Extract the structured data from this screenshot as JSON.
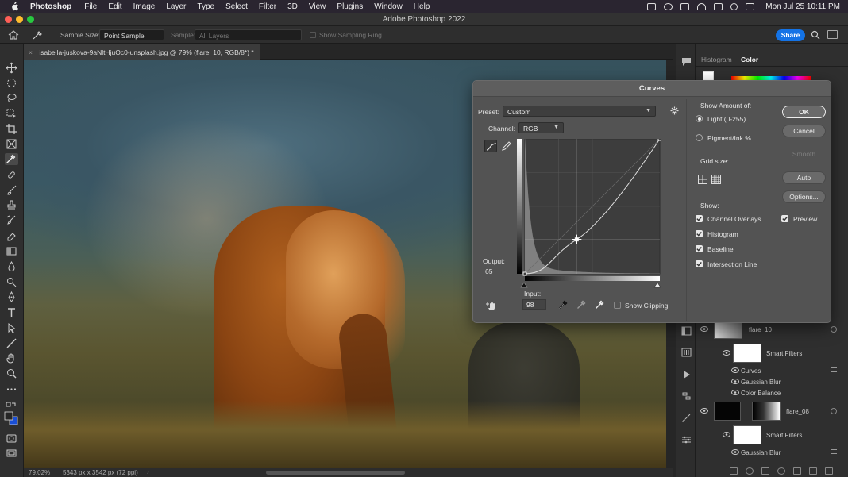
{
  "menubar": {
    "app": "Photoshop",
    "items": [
      "File",
      "Edit",
      "Image",
      "Layer",
      "Type",
      "Select",
      "Filter",
      "3D",
      "View",
      "Plugins",
      "Window",
      "Help"
    ],
    "clock": "Mon Jul 25  10:11 PM"
  },
  "window": {
    "title": "Adobe Photoshop 2022"
  },
  "options": {
    "sample_size_label": "Sample Size:",
    "sample_size_value": "Point Sample",
    "sample_label": "Sample:",
    "sample_value": "All Layers",
    "show_ring_label": "Show Sampling Ring",
    "share_label": "Share"
  },
  "document": {
    "tab": "isabella-juskova-9aNltHjuOc0-unsplash.jpg @ 79% (flare_10, RGB/8*) *",
    "close": "×"
  },
  "status": {
    "zoom": "79.02%",
    "dimensions": "5343 px x 3542 px (72 ppi)",
    "arrow": "›"
  },
  "right_panel": {
    "tabs": [
      "Histogram",
      "Color"
    ],
    "active_tab": "Color",
    "layers": [
      {
        "name": "flare_10",
        "type": "layer"
      },
      {
        "name": "Smart Filters",
        "type": "smart"
      },
      {
        "name": "Curves",
        "type": "filter"
      },
      {
        "name": "Gaussian Blur",
        "type": "filter"
      },
      {
        "name": "Color Balance",
        "type": "filter"
      },
      {
        "name": "flare_08",
        "type": "layer"
      },
      {
        "name": "Smart Filters",
        "type": "smart"
      },
      {
        "name": "Gaussian Blur",
        "type": "filter"
      }
    ]
  },
  "curves": {
    "title": "Curves",
    "preset_label": "Preset:",
    "preset_value": "Custom",
    "channel_label": "Channel:",
    "channel_value": "RGB",
    "output_label": "Output:",
    "output_value": "65",
    "input_label": "Input:",
    "input_value": "98",
    "show_clipping": "Show Clipping",
    "show_amount_label": "Show Amount of:",
    "light_label": "Light  (0-255)",
    "pigment_label": "Pigment/Ink %",
    "grid_size_label": "Grid size:",
    "show_label": "Show:",
    "channel_overlays": "Channel Overlays",
    "histogram": "Histogram",
    "baseline": "Baseline",
    "intersection_line": "Intersection Line",
    "preview": "Preview",
    "buttons": {
      "ok": "OK",
      "cancel": "Cancel",
      "smooth": "Smooth",
      "auto": "Auto",
      "options": "Options..."
    },
    "checks": {
      "channel_overlays": true,
      "histogram": true,
      "baseline": true,
      "intersection_line": true,
      "preview": true,
      "show_clipping": false
    },
    "mode": "Light",
    "curve_points": [
      [
        0,
        0
      ],
      [
        98,
        65
      ],
      [
        255,
        255
      ]
    ]
  }
}
